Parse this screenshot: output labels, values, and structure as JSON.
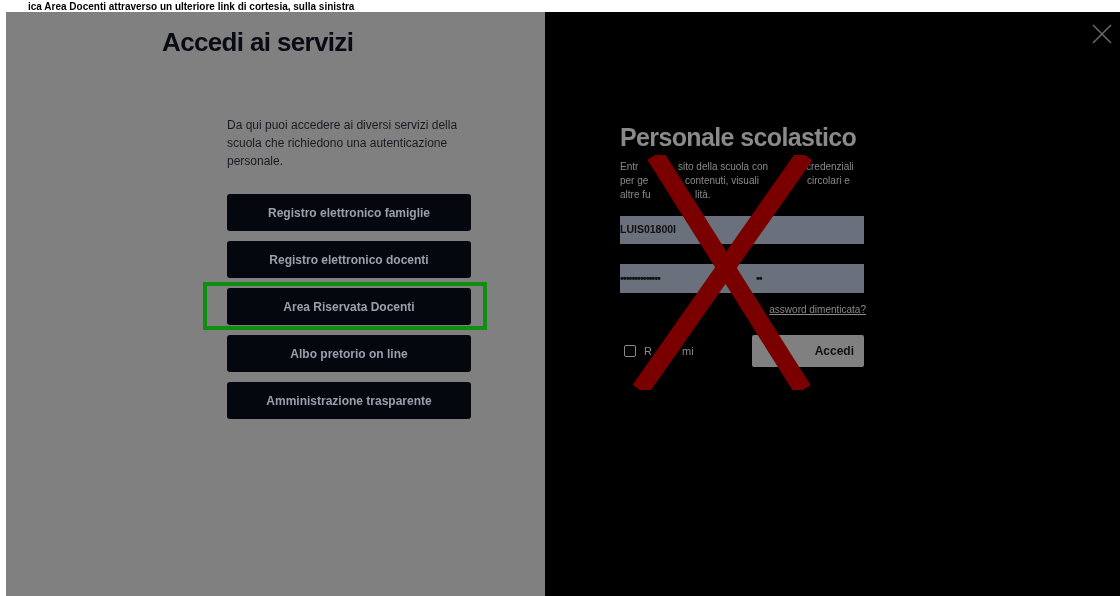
{
  "caption": "ica Area Docenti attraverso un ulteriore link di cortesia, sulla sinistra",
  "left_panel": {
    "title": "Accedi ai servizi",
    "intro": "Da qui puoi accedere ai diversi servizi della scuola che richiedono una autenticazione personale.",
    "services": [
      {
        "label": "Registro elettronico famiglie",
        "highlighted": false
      },
      {
        "label": "Registro elettronico docenti",
        "highlighted": false
      },
      {
        "label": "Area Riservata Docenti",
        "highlighted": true
      },
      {
        "label": "Albo pretorio on line",
        "highlighted": false
      },
      {
        "label": "Amministrazione trasparente",
        "highlighted": false
      }
    ]
  },
  "login_panel": {
    "title": "Personale scolastico",
    "description_lines": [
      [
        "Entr",
        "sito della scuola con",
        "credenziali"
      ],
      [
        "per ge",
        "contenuti, visuali",
        "circolari e"
      ],
      [
        "altre fu",
        "lità."
      ]
    ],
    "username": "LUIS01800I",
    "password": [
      "••••••••••••••",
      "••"
    ],
    "forgot_link": "assword dimenticata?",
    "remember": {
      "label": [
        "R",
        "mi"
      ],
      "checked": false
    },
    "submit": "Accedi",
    "crossed_out": true
  }
}
